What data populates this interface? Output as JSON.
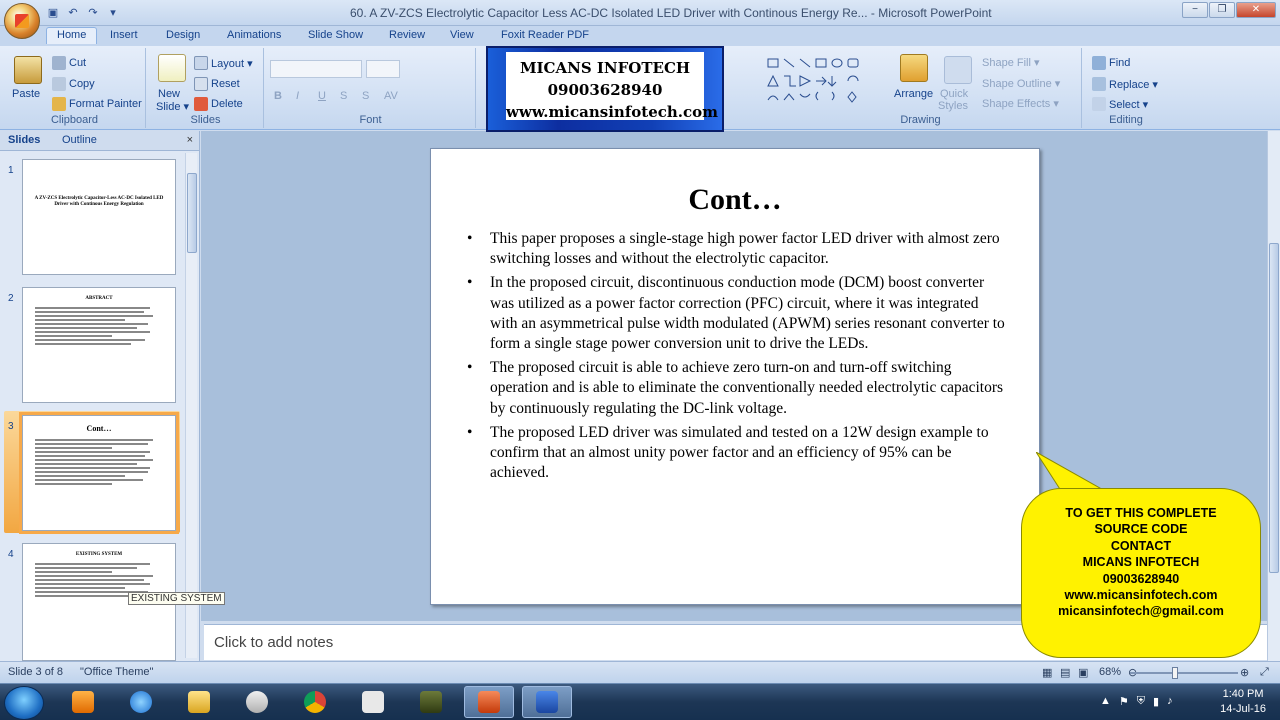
{
  "window": {
    "title": "60. A ZV-ZCS Electrolytic Capacitor Less AC-DC Isolated LED Driver with Continous Energy Re...  -  Microsoft PowerPoint",
    "minimize": "−",
    "restore": "❐",
    "close": "✕"
  },
  "ribbon": {
    "tabs": [
      "Home",
      "Insert",
      "Design",
      "Animations",
      "Slide Show",
      "Review",
      "View",
      "Foxit Reader PDF"
    ],
    "clipboard": {
      "paste": "Paste",
      "cut": "Cut",
      "copy": "Copy",
      "format_painter": "Format Painter",
      "label": "Clipboard"
    },
    "slides": {
      "new_slide": "New",
      "new_slide2": "Slide ▾",
      "layout": "Layout ▾",
      "reset": "Reset",
      "delete": "Delete",
      "label": "Slides"
    },
    "font": {
      "label": "Font"
    },
    "drawing": {
      "arrange": "Arrange",
      "quick_styles": "Quick",
      "quick_styles2": "Styles",
      "shape_fill": "Shape Fill ▾",
      "shape_outline": "Shape Outline ▾",
      "shape_effects": "Shape Effects ▾",
      "label": "Drawing"
    },
    "editing": {
      "find": "Find",
      "replace": "Replace ▾",
      "select": "Select ▾",
      "label": "Editing"
    }
  },
  "banner": {
    "line1": "MICANS INFOTECH",
    "line2": "09003628940",
    "line3": "www.micansinfotech.com"
  },
  "left_pane": {
    "tab_slides": "Slides",
    "tab_outline": "Outline",
    "close": "×",
    "thumbs": [
      {
        "num": "1",
        "title": "A ZV-ZCS Electrolytic Capacitor-Less AC-DC Isolated LED Driver with Continous Energy Regulation"
      },
      {
        "num": "2",
        "title": "ABSTRACT"
      },
      {
        "num": "3",
        "title": "Cont…"
      },
      {
        "num": "4",
        "title": "EXISTING SYSTEM"
      }
    ],
    "tooltip": "EXISTING SYSTEM"
  },
  "slide": {
    "title": "Cont…",
    "bullets": [
      "This paper proposes a single-stage high power factor LED driver with almost zero switching losses and without the electrolytic capacitor.",
      "In the proposed circuit, discontinuous conduction mode (DCM) boost converter was utilized as a power factor correction (PFC) circuit, where it was integrated with an asymmetrical pulse width modulated (APWM) series resonant converter to  form a single stage power conversion unit to drive the LEDs.",
      "The proposed circuit is able to achieve zero turn-on and turn-off switching operation and is able to eliminate the conventionally needed electrolytic capacitors by continuously regulating the DC-link voltage.",
      "The proposed LED driver was simulated and tested on a 12W design example to confirm that an almost unity power factor and an efficiency of 95% can be achieved."
    ]
  },
  "notes": {
    "placeholder": "Click to add notes"
  },
  "callout": {
    "lines": [
      "TO GET THIS COMPLETE",
      "SOURCE CODE",
      "CONTACT",
      "MICANS INFOTECH",
      "09003628940",
      "www.micansinfotech.com",
      "micansinfotech@gmail.com"
    ]
  },
  "status": {
    "slide_of": "Slide 3 of 8",
    "theme": "\"Office Theme\"",
    "zoom": "68%"
  },
  "taskbar": {
    "time": "1:40 PM",
    "date": "14-Jul-16"
  },
  "colors": {
    "ribbon_bg": "#d3e1f4",
    "banner_blue": "#0d2ea0",
    "callout_yellow": "#fff200",
    "selected_thumb": "#f2a742"
  }
}
